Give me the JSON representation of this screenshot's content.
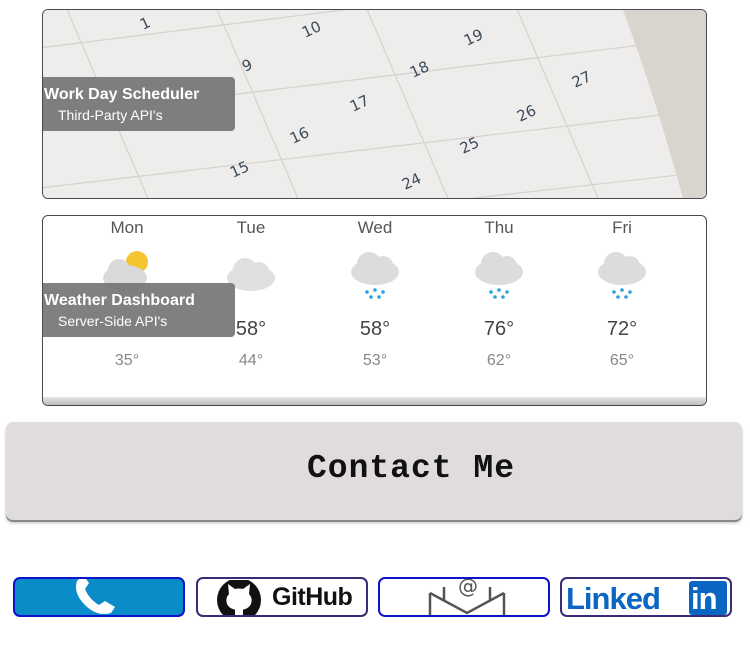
{
  "projects": [
    {
      "title": "Work Day Scheduler",
      "subtitle": "Third-Party API's"
    },
    {
      "title": "Weather Dashboard",
      "subtitle": "Server-Side API's"
    }
  ],
  "calendar_numbers": [
    "1",
    "10",
    "19",
    "9",
    "18",
    "27",
    "17",
    "26",
    "16",
    "25",
    "15",
    "24"
  ],
  "forecast": [
    {
      "day": "Mon",
      "icon": "partly-cloudy-icon",
      "high": "",
      "low": "35°"
    },
    {
      "day": "Tue",
      "icon": "cloudy-icon",
      "high": "58°",
      "low": "44°"
    },
    {
      "day": "Wed",
      "icon": "snow-icon",
      "high": "58°",
      "low": "53°"
    },
    {
      "day": "Thu",
      "icon": "snow-icon",
      "high": "76°",
      "low": "62°"
    },
    {
      "day": "Fri",
      "icon": "snow-icon",
      "high": "72°",
      "low": "65°"
    }
  ],
  "contact": {
    "label": "Contact Me"
  },
  "social": {
    "phone_icon": "phone-icon",
    "github_label": "GitHub",
    "email_icon": "email-icon",
    "linkedin_label": "Linked",
    "linkedin_badge": "in"
  },
  "colors": {
    "caption_bg": "#6e6e6e",
    "phone_bg": "#0a8cc8",
    "border_blue": "#0a14c8",
    "linkedin_blue": "#0a66c2",
    "contact_bg": "#e0dcdc"
  }
}
